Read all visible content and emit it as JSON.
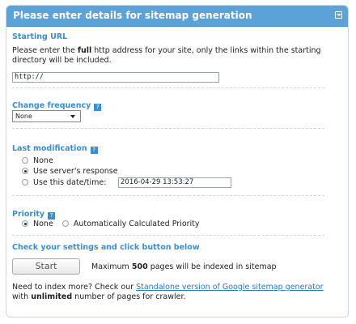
{
  "header": {
    "title": "Please enter details for sitemap generation"
  },
  "starting_url": {
    "title": "Starting URL",
    "desc_part1": "Please enter the ",
    "desc_bold": "full",
    "desc_part2": " http address for your site, only the links within the starting",
    "desc_line2": "directory will be included.",
    "value": "http://"
  },
  "change_frequency": {
    "title": "Change frequency",
    "help": "?",
    "selected": "None"
  },
  "last_modification": {
    "title": "Last modification",
    "help": "?",
    "options": [
      "None",
      "Use server's response",
      "Use this date/time:"
    ],
    "selected_index": 1,
    "datetime_value": "2016-04-29 13:53:27"
  },
  "priority": {
    "title": "Priority",
    "help": "?",
    "options": [
      "None",
      "Automatically Calculated Priority"
    ],
    "selected_index": 0
  },
  "check": {
    "title": "Check your settings and click button below",
    "button": "Start",
    "max_part1": "Maximum ",
    "max_bold": "500",
    "max_part2": " pages will be indexed in sitemap"
  },
  "more": {
    "part1": "Need to index more? Check our ",
    "link": "Standalone version of Google sitemap generator",
    "part2": "with ",
    "bold": "unlimited",
    "part3": " number of pages for crawler."
  },
  "colors": {
    "header": "#5aa2d8",
    "title": "#3a8fd0",
    "link": "#2a7ab8"
  }
}
